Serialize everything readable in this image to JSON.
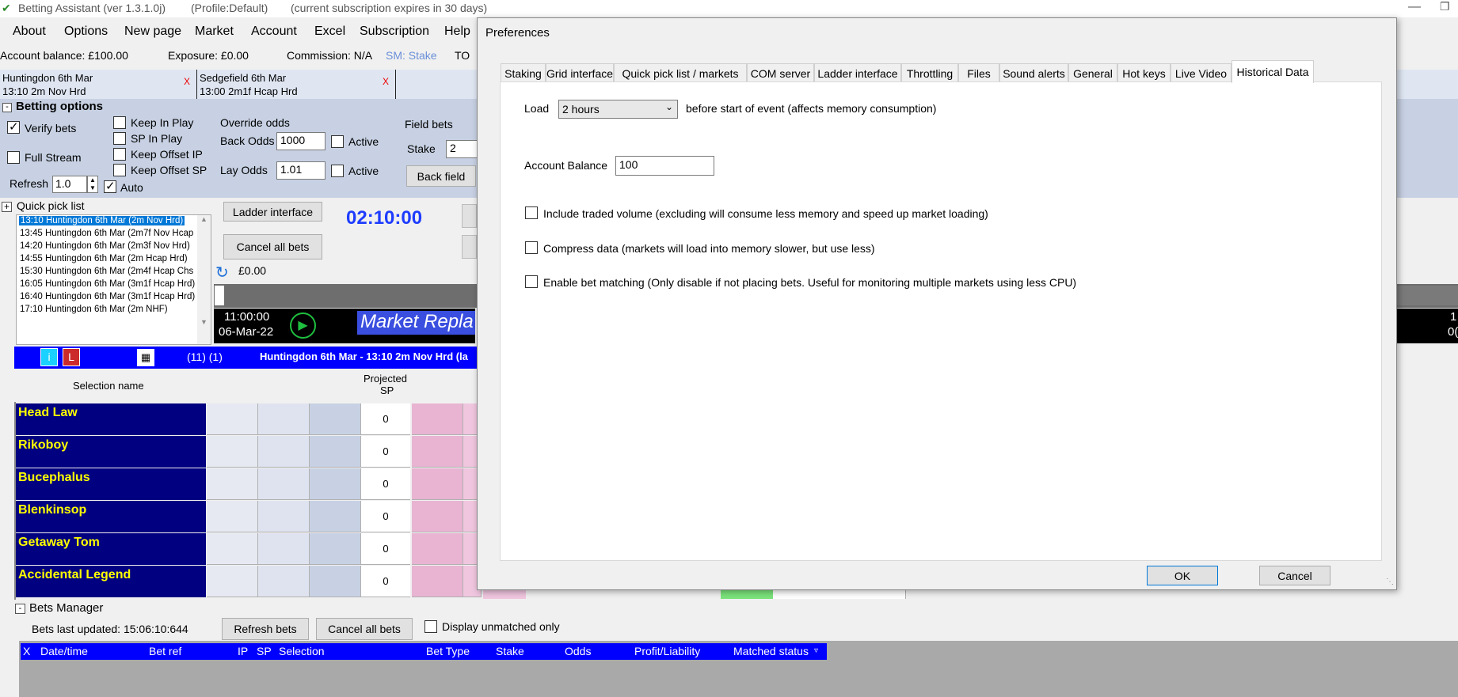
{
  "window": {
    "title": "Betting Assistant (ver 1.3.1.0j)",
    "profile": "(Profile:Default)",
    "subscription": "(current subscription expires in 30 days)"
  },
  "menu": [
    "About",
    "Options",
    "New page",
    "Market",
    "Account",
    "Excel",
    "Subscription",
    "Help"
  ],
  "status": {
    "balance": "Account balance: £100.00",
    "exposure": "Exposure: £0.00",
    "commission": "Commission: N/A",
    "sm": "SM: Stake",
    "to": "TO"
  },
  "event_tabs": [
    {
      "line1": "Huntingdon 6th Mar",
      "line2": "13:10 2m Nov Hrd",
      "close": "X"
    },
    {
      "line1": "Sedgefield 6th Mar",
      "line2": "13:00 2m1f Hcap Hrd",
      "close": "X"
    }
  ],
  "betting": {
    "title": "Betting options",
    "verify": "Verify bets",
    "full_stream": "Full Stream",
    "refresh": "Refresh",
    "refresh_val": "1.0",
    "auto": "Auto",
    "keep_in_play": "Keep In Play",
    "sp_in_play": "SP In Play",
    "keep_offset_ip": "Keep Offset IP",
    "keep_offset_sp": "Keep Offset SP",
    "override": "Override odds",
    "back_odds": "Back Odds",
    "back_val": "1000",
    "lay_odds": "Lay Odds",
    "lay_val": "1.01",
    "active": "Active",
    "field_bets": "Field bets",
    "stake": "Stake",
    "stake_val": "2",
    "back_field": "Back field"
  },
  "quickpick": {
    "title": "Quick pick list",
    "items": [
      "13:10 Huntingdon 6th Mar (2m Nov Hrd)",
      "13:45 Huntingdon 6th Mar (2m7f Nov Hcap",
      "14:20 Huntingdon 6th Mar (2m3f Nov Hrd)",
      "14:55 Huntingdon 6th Mar (2m Hcap Hrd)",
      "15:30 Huntingdon 6th Mar (2m4f Hcap Chs",
      "16:05 Huntingdon 6th Mar (3m1f Hcap Hrd)",
      "16:40 Huntingdon 6th Mar (3m1f Hcap Hrd)",
      "17:10 Huntingdon 6th Mar (2m NHF)"
    ]
  },
  "controls": {
    "ladder": "Ladder interface",
    "cancel_all": "Cancel all bets",
    "timer": "02:10:00",
    "amount": "£0.00",
    "replay_time": "11:00:00",
    "replay_date": "06-Mar-22",
    "replay_title": "Market Repla",
    "right_1": "1",
    "right_2": "0("
  },
  "market_bar": {
    "i": "i",
    "l": "L",
    "count": "(11) (1)",
    "title": "Huntingdon 6th Mar - 13:10 2m Nov Hrd (la"
  },
  "grid": {
    "sel_header": "Selection name",
    "proj_header1": "Projected",
    "proj_header2": "SP",
    "runners": [
      "Head Law",
      "Rikoboy",
      "Bucephalus",
      "Blenkinsop",
      "Getaway Tom",
      "Accidental Legend"
    ],
    "proj_values": [
      "0",
      "0",
      "0",
      "0",
      "0",
      "0"
    ]
  },
  "bets": {
    "title": "Bets Manager",
    "updated": "Bets last updated: 15:06:10:644",
    "refresh": "Refresh bets",
    "cancel": "Cancel all bets",
    "unmatched": "Display unmatched only",
    "columns": [
      "X",
      "Date/time",
      "Bet ref",
      "IP",
      "SP",
      "Selection",
      "Bet Type",
      "Stake",
      "Odds",
      "Profit/Liability",
      "Matched status"
    ]
  },
  "dialog": {
    "title": "Preferences",
    "tabs": [
      "Staking",
      "Grid interface",
      "Quick pick list / markets",
      "COM server",
      "Ladder interface",
      "Throttling",
      "Files",
      "Sound alerts",
      "General",
      "Hot keys",
      "Live Video",
      "Historical Data"
    ],
    "load": "Load",
    "load_value": "2 hours",
    "load_suffix": "before start of event (affects memory consumption)",
    "acct_bal": "Account Balance",
    "acct_val": "100",
    "opt1": "Include traded volume (excluding will consume less memory and speed up market loading)",
    "opt2": "Compress data (markets will load into memory slower, but use less)",
    "opt3": "Enable bet matching (Only disable if not placing bets. Useful for monitoring multiple markets using less CPU)",
    "ok": "OK",
    "cancel": "Cancel"
  },
  "colors": {
    "navy": "#000080",
    "blue": "#0000ff",
    "yellow": "#ffff00",
    "pink": "#e8b4d2"
  }
}
